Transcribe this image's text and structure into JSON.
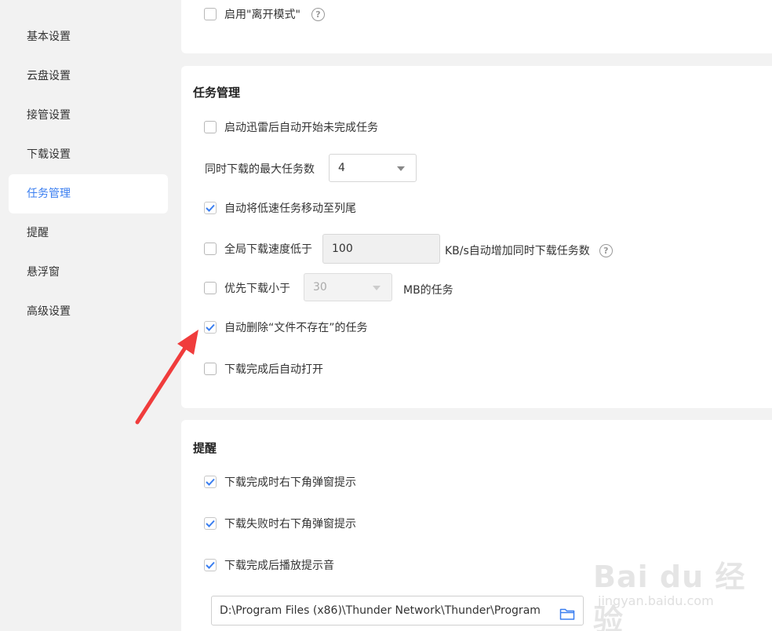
{
  "sidebar": {
    "items": [
      {
        "label": "基本设置",
        "active": false
      },
      {
        "label": "云盘设置",
        "active": false
      },
      {
        "label": "接管设置",
        "active": false
      },
      {
        "label": "下载设置",
        "active": false
      },
      {
        "label": "任务管理",
        "active": true
      },
      {
        "label": "提醒",
        "active": false
      },
      {
        "label": "悬浮窗",
        "active": false
      },
      {
        "label": "高级设置",
        "active": false
      }
    ]
  },
  "top_card": {
    "away_mode": {
      "label": "启用\"离开模式\"",
      "checked": false
    }
  },
  "task_card": {
    "title": "任务管理",
    "auto_start": {
      "label": "启动迅雷后自动开始未完成任务",
      "checked": false
    },
    "max_tasks": {
      "label": "同时下载的最大任务数",
      "value": "4"
    },
    "move_slow": {
      "label": "自动将低速任务移动至列尾",
      "checked": true
    },
    "speed_rule": {
      "label": "全局下载速度低于",
      "checked": false,
      "value": "100",
      "suffix": "KB/s自动增加同时下载任务数"
    },
    "small_first": {
      "label": "优先下载小于",
      "checked": false,
      "value": "30",
      "suffix": "MB的任务"
    },
    "auto_delete": {
      "label": "自动删除“文件不存在”的任务",
      "checked": true
    },
    "auto_open": {
      "label": "下载完成后自动打开",
      "checked": false
    }
  },
  "remind_card": {
    "title": "提醒",
    "complete_popup": {
      "label": "下载完成时右下角弹窗提示",
      "checked": true
    },
    "fail_popup": {
      "label": "下载失败时右下角弹窗提示",
      "checked": true
    },
    "complete_sound": {
      "label": "下载完成后播放提示音",
      "checked": true
    },
    "sound_path": "D:\\Program Files (x86)\\Thunder Network\\Thunder\\Program"
  },
  "watermark": {
    "main": "Bai du 经验",
    "sub": "jingyan.baidu.com"
  },
  "colors": {
    "accent": "#3a7ef0",
    "arrow": "#f03c3c",
    "check": "#3a7ef0"
  },
  "icons": {
    "help": "question-circle-icon",
    "folder": "folder-icon",
    "check": "check-icon",
    "caret": "caret-down-icon"
  }
}
